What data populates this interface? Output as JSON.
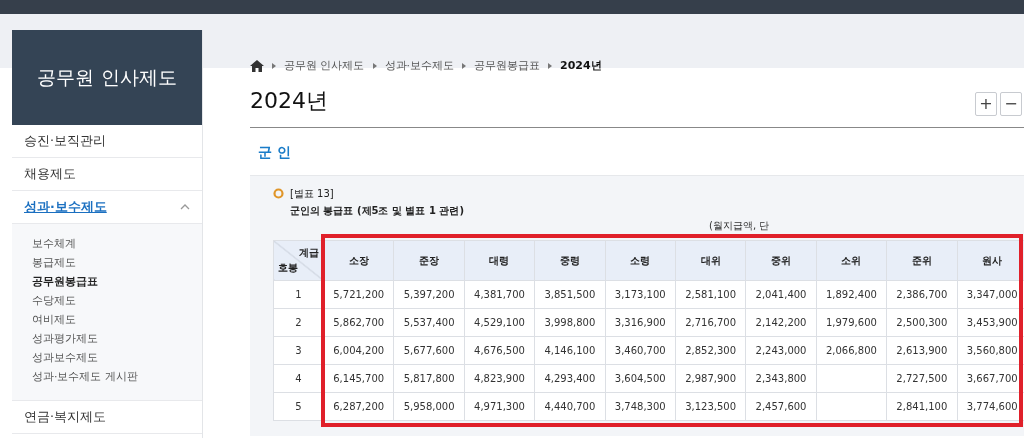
{
  "sidebar": {
    "title": "공무원 인사제도",
    "items": [
      {
        "label": "승진·보직관리",
        "selected": false,
        "expanded": false
      },
      {
        "label": "채용제도",
        "selected": false,
        "expanded": false
      },
      {
        "label": "성과·보수제도",
        "selected": true,
        "expanded": true,
        "children": [
          {
            "label": "보수체계",
            "selected": false
          },
          {
            "label": "봉급제도",
            "selected": false
          },
          {
            "label": "공무원봉급표",
            "selected": true
          },
          {
            "label": "수당제도",
            "selected": false
          },
          {
            "label": "여비제도",
            "selected": false
          },
          {
            "label": "성과평가제도",
            "selected": false
          },
          {
            "label": "성과보수제도",
            "selected": false
          },
          {
            "label": "성과·보수제도 게시판",
            "selected": false
          }
        ]
      },
      {
        "label": "연금·복지제도",
        "selected": false,
        "expanded": false
      }
    ]
  },
  "breadcrumb": [
    "공무원 인사제도",
    "성과·보수제도",
    "공무원봉급표",
    "2024년"
  ],
  "page_title": "2024년",
  "zoom_buttons": [
    "+",
    "−"
  ],
  "section_title": "군 인",
  "table_caption": {
    "label": "[별표 13]",
    "title": "군인의 봉급표 (제5조 및 별표 1 관련)"
  },
  "unit_note": "(월지급액, 단",
  "table": {
    "corner_top": "계급",
    "corner_bottom": "호봉",
    "highlighted": true,
    "columns": [
      "소장",
      "준장",
      "대령",
      "중령",
      "소령",
      "대위",
      "중위",
      "소위",
      "준위",
      "원사"
    ],
    "rows": [
      {
        "step": "1",
        "cells": [
          "5,721,200",
          "5,397,200",
          "4,381,700",
          "3,851,500",
          "3,173,100",
          "2,581,100",
          "2,041,400",
          "1,892,400",
          "2,386,700",
          "3,347,000"
        ]
      },
      {
        "step": "2",
        "cells": [
          "5,862,700",
          "5,537,400",
          "4,529,100",
          "3,998,800",
          "3,316,900",
          "2,716,700",
          "2,142,200",
          "1,979,600",
          "2,500,300",
          "3,453,900"
        ]
      },
      {
        "step": "3",
        "cells": [
          "6,004,200",
          "5,677,600",
          "4,676,500",
          "4,146,100",
          "3,460,700",
          "2,852,300",
          "2,243,000",
          "2,066,800",
          "2,613,900",
          "3,560,800"
        ]
      },
      {
        "step": "4",
        "cells": [
          "6,145,700",
          "5,817,800",
          "4,823,900",
          "4,293,400",
          "3,604,500",
          "2,987,900",
          "2,343,800",
          "",
          "2,727,500",
          "3,667,700"
        ]
      },
      {
        "step": "5",
        "cells": [
          "6,287,200",
          "5,958,000",
          "4,971,300",
          "4,440,700",
          "3,748,300",
          "3,123,500",
          "2,457,600",
          "",
          "2,841,100",
          "3,774,600"
        ]
      }
    ]
  }
}
